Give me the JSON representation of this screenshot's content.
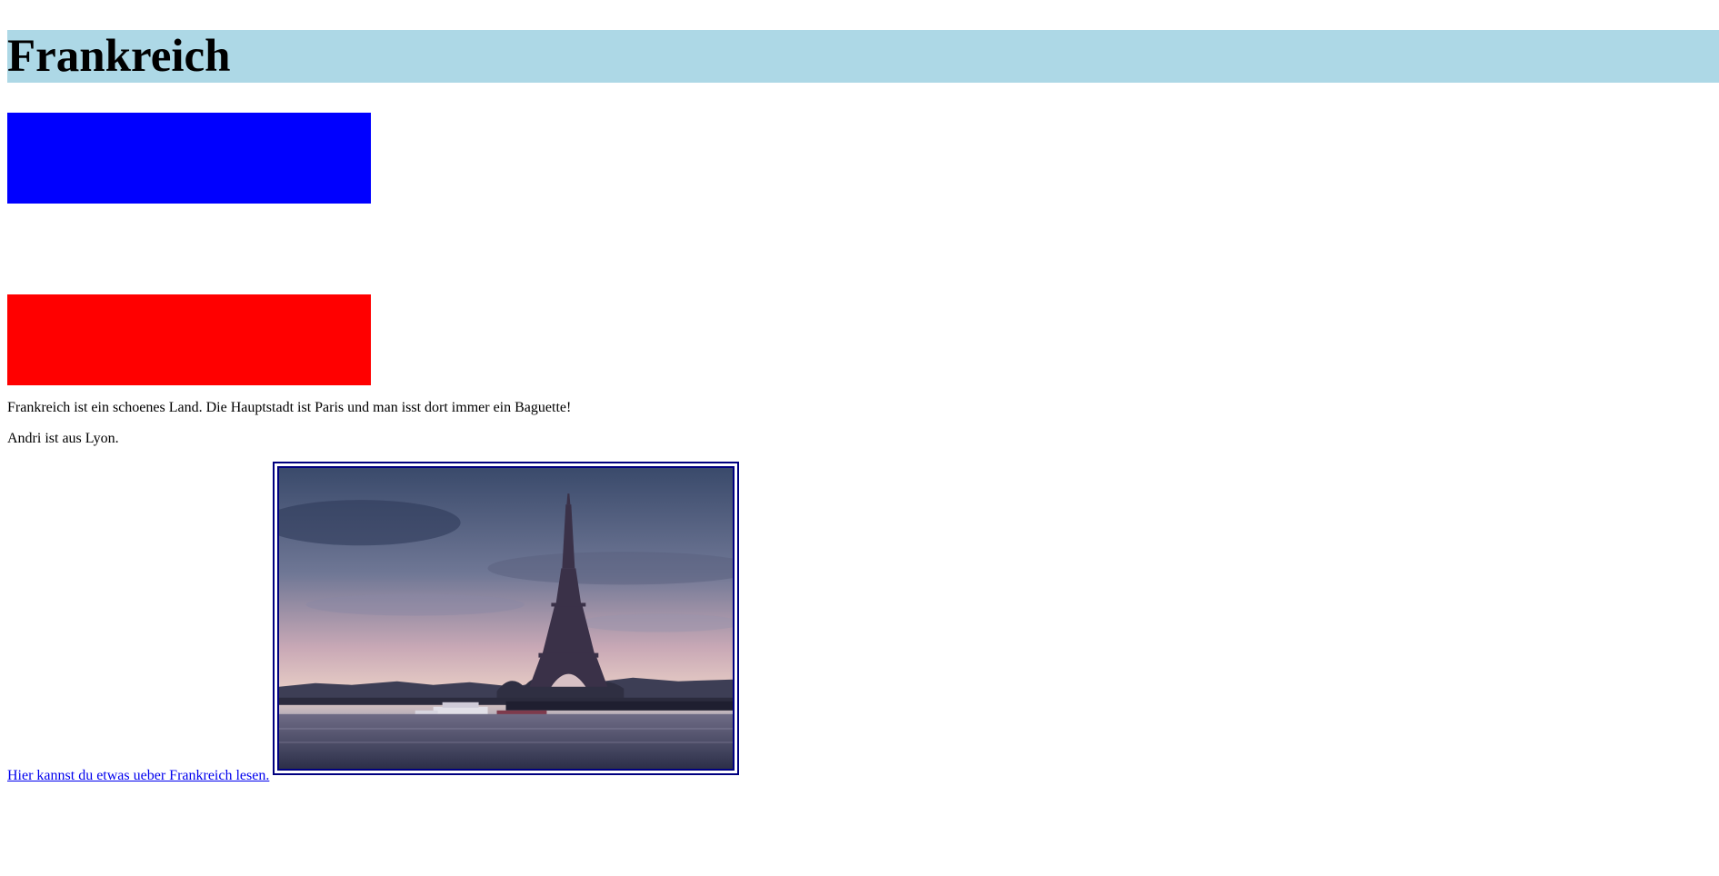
{
  "header": {
    "title": "Frankreich",
    "background": "#add8e6"
  },
  "flag_blocks": {
    "top_color": "#0000ff",
    "bottom_color": "#ff0000"
  },
  "content": {
    "paragraph_1": "Frankreich ist ein schoenes Land. Die Hauptstadt ist Paris und man isst dort immer ein Baguette!",
    "paragraph_2": "Andri ist aus Lyon."
  },
  "link": {
    "text": "Hier kannst du etwas ueber Frankreich lesen.",
    "color": "#0000ee"
  },
  "image": {
    "subject": "eiffel-tower-paris-seine-photo",
    "border_color": "#000080"
  }
}
